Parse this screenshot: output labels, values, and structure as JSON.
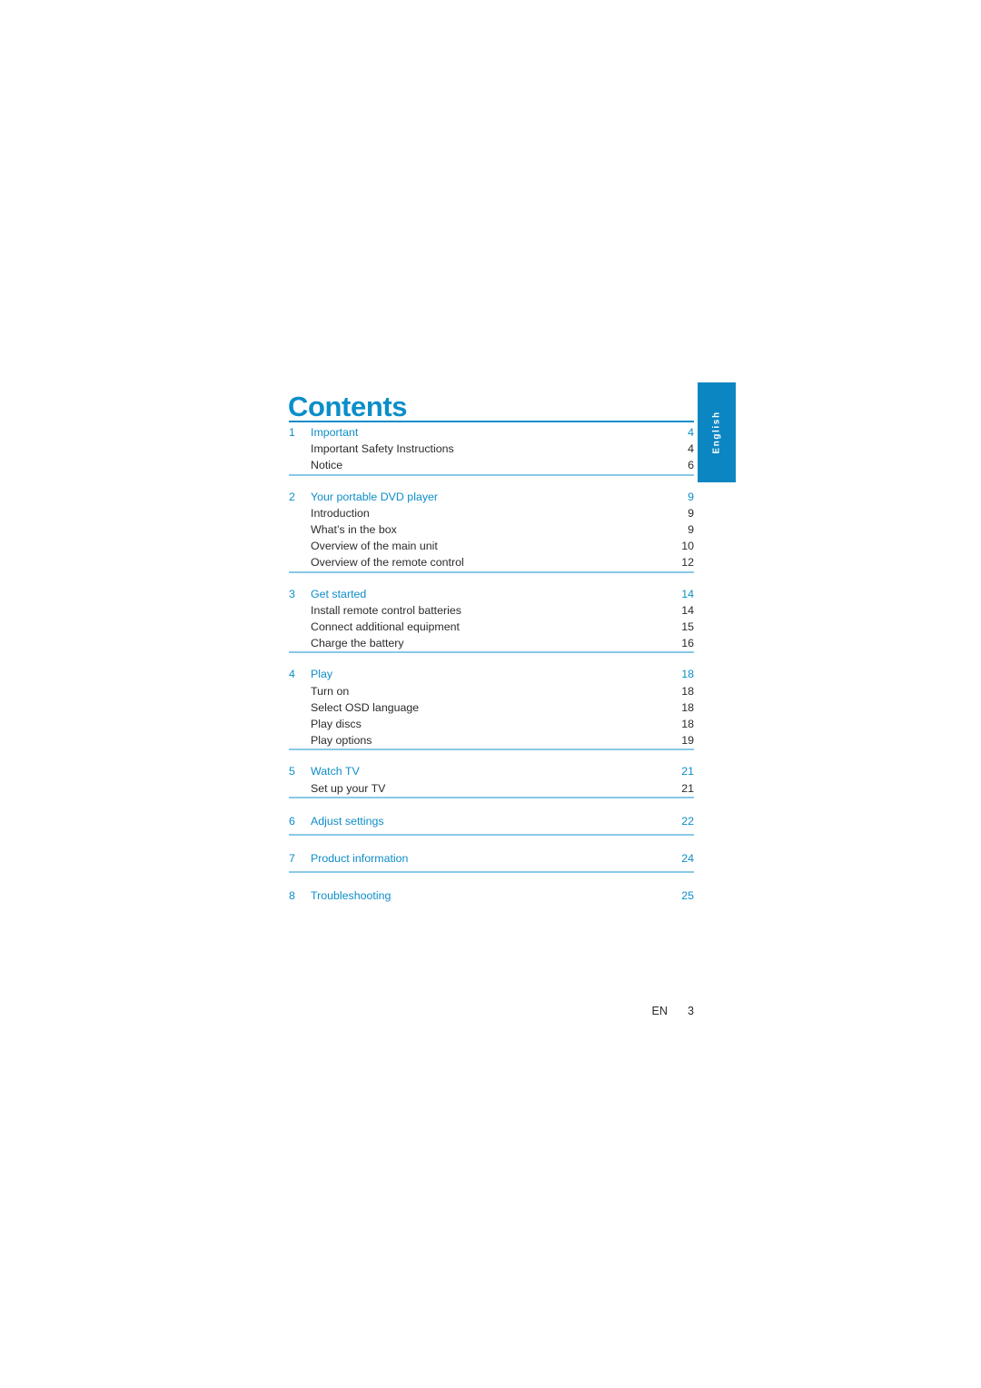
{
  "document": {
    "title": "Contents",
    "language_tab": "English",
    "footer": {
      "locale": "EN",
      "page_number": "3"
    }
  },
  "colors": {
    "heading_blue": "#0b8ec9",
    "entry_blue": "#0d8dc8",
    "rule_blue": "#0d8dc8",
    "rule_light_blue": "#8ac8e8",
    "tab_blue": "#0b86c3",
    "body_text": "#2b2b2b"
  },
  "toc": {
    "sections": [
      {
        "number": "1",
        "title": "Important",
        "page": "4",
        "entries": [
          {
            "label": "Important Safety Instructions",
            "page": "4"
          },
          {
            "label": "Notice",
            "page": "6"
          }
        ]
      },
      {
        "number": "2",
        "title": "Your portable DVD player",
        "page": "9",
        "entries": [
          {
            "label": "Introduction",
            "page": "9"
          },
          {
            "label": "What’s in the box",
            "page": "9"
          },
          {
            "label": "Overview of the main unit",
            "page": "10"
          },
          {
            "label": "Overview of the remote control",
            "page": "12"
          }
        ]
      },
      {
        "number": "3",
        "title": "Get started",
        "page": "14",
        "entries": [
          {
            "label": "Install remote control batteries",
            "page": "14"
          },
          {
            "label": "Connect additional equipment",
            "page": "15"
          },
          {
            "label": "Charge the battery",
            "page": "16"
          }
        ]
      },
      {
        "number": "4",
        "title": "Play",
        "page": "18",
        "entries": [
          {
            "label": "Turn on",
            "page": "18"
          },
          {
            "label": "Select OSD language",
            "page": "18"
          },
          {
            "label": "Play discs",
            "page": "18"
          },
          {
            "label": "Play options",
            "page": "19"
          }
        ]
      },
      {
        "number": "5",
        "title": "Watch TV",
        "page": "21",
        "entries": [
          {
            "label": "Set up your TV",
            "page": "21"
          }
        ]
      },
      {
        "number": "6",
        "title": "Adjust settings",
        "page": "22",
        "entries": []
      },
      {
        "number": "7",
        "title": "Product information",
        "page": "24",
        "entries": []
      },
      {
        "number": "8",
        "title": "Troubleshooting",
        "page": "25",
        "entries": []
      }
    ]
  }
}
